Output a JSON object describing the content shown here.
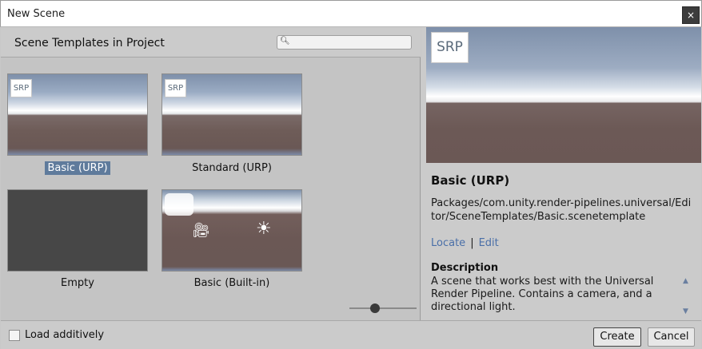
{
  "window": {
    "title": "New Scene",
    "close_glyph": "×"
  },
  "left": {
    "heading": "Scene Templates in Project",
    "search_placeholder": "",
    "templates": [
      {
        "label": "Basic (URP)",
        "badge": "SRP",
        "selected": true
      },
      {
        "label": "Standard (URP)",
        "badge": "SRP",
        "selected": false
      },
      {
        "label": "Empty",
        "selected": false
      },
      {
        "label": "Basic (Built-in)",
        "selected": false
      }
    ],
    "zoom_level": 0.4
  },
  "details": {
    "badge": "SRP",
    "title": "Basic (URP)",
    "path": "Packages/com.unity.render-pipelines.universal/Editor/SceneTemplates/Basic.scenetemplate",
    "locate_label": "Locate",
    "separator": "|",
    "edit_label": "Edit",
    "description_heading": "Description",
    "description": "A scene that works best with the Universal Render Pipeline. Contains a camera, and a directional light."
  },
  "footer": {
    "load_additively_label": "Load additively",
    "load_additively_checked": false,
    "create_label": "Create",
    "cancel_label": "Cancel"
  },
  "icons": [
    "search-icon",
    "close-icon",
    "camera-icon",
    "sun-icon",
    "scroll-up-icon",
    "scroll-down-icon"
  ],
  "colors": {
    "selection": "#5f7b9c",
    "link": "#4a6fa8"
  }
}
